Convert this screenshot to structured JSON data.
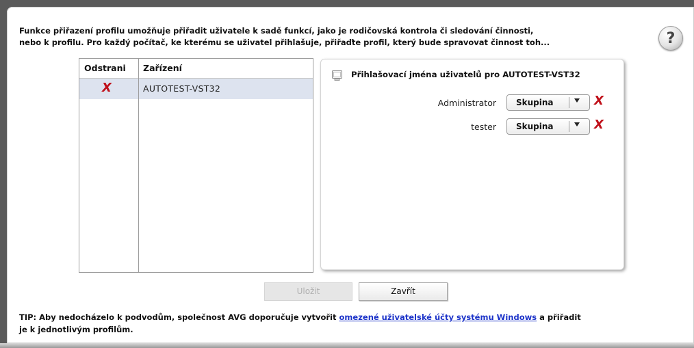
{
  "intro": {
    "line1": "Funkce přiřazení profilu umožňuje přiřadit uživatele k sadě funkcí, jako je rodičovská kontrola či sledování činnosti,",
    "line2": "nebo k profilu. Pro každý počítač, ke kterému se uživatel přihlašuje, přiřaďte profil, který bude spravovat činnost toh..."
  },
  "help_icon": "question-mark",
  "device_table": {
    "col_remove": "Odstrani",
    "col_device": "Zařízení",
    "rows": [
      {
        "remove_icon": "X",
        "device": "AUTOTEST-VST32"
      }
    ]
  },
  "user_panel": {
    "title": "Přihlašovací jména uživatelů pro AUTOTEST-VST32",
    "users": [
      {
        "name": "Administrator",
        "profile": "Skupina",
        "remove_icon": "X"
      },
      {
        "name": "tester",
        "profile": "Skupina",
        "remove_icon": "X"
      }
    ]
  },
  "buttons": {
    "save": "Uložit",
    "close": "Zavřít"
  },
  "tip": {
    "prefix": "TIP: Aby nedocházelo k podvodům, společnost AVG doporučuje vytvořit ",
    "link": "omezené uživatelské účty systému Windows",
    "suffix": " a přiřadit",
    "line2": "je k jednotlivým profilům."
  },
  "colors": {
    "remove_red": "#c0101a",
    "link_blue": "#1d34c9",
    "selected_row": "#dde3ef"
  }
}
